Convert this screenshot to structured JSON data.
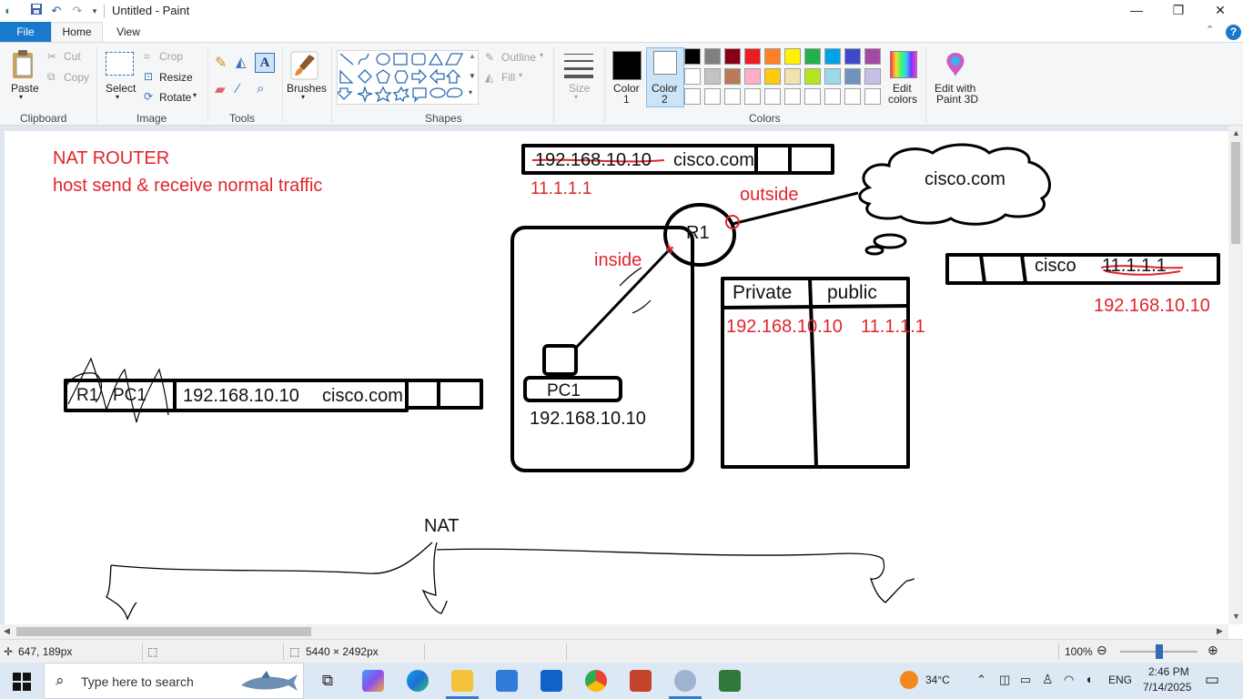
{
  "window": {
    "title": "Untitled - Paint",
    "quick_access": [
      "save-icon",
      "undo-icon",
      "redo-icon",
      "customize-icon"
    ],
    "controls": [
      "minimize",
      "restore",
      "close"
    ]
  },
  "tabs": {
    "file": "File",
    "home": "Home",
    "view": "View",
    "help": "?"
  },
  "ribbon": {
    "clipboard": {
      "paste": "Paste",
      "cut": "Cut",
      "copy": "Copy",
      "label": "Clipboard"
    },
    "image": {
      "select": "Select",
      "crop": "Crop",
      "resize": "Resize",
      "rotate": "Rotate",
      "label": "Image"
    },
    "tools": {
      "label": "Tools"
    },
    "brushes": {
      "label": "Brushes"
    },
    "shapes": {
      "outline": "Outline",
      "fill": "Fill",
      "label": "Shapes"
    },
    "size": {
      "label": "Size"
    },
    "color1": {
      "line1": "Color",
      "line2": "1"
    },
    "color2": {
      "line1": "Color",
      "line2": "2"
    },
    "colors": {
      "label": "Colors",
      "row1": [
        "#000000",
        "#7f7f7f",
        "#880015",
        "#ed1c24",
        "#ff7f27",
        "#fff200",
        "#22b14c",
        "#00a2e8",
        "#3f48cc",
        "#a349a4"
      ],
      "row2": [
        "#ffffff",
        "#c3c3c3",
        "#b97a57",
        "#ffaec9",
        "#ffc90e",
        "#efe4b0",
        "#b5e61d",
        "#99d9ea",
        "#7092be",
        "#c8bfe7"
      ],
      "row3": [
        "#ffffff",
        "#ffffff",
        "#ffffff",
        "#ffffff",
        "#ffffff",
        "#ffffff",
        "#ffffff",
        "#ffffff",
        "#ffffff",
        "#ffffff"
      ]
    },
    "edit_colors": {
      "line1": "Edit",
      "line2": "colors"
    },
    "paint3d": {
      "line1": "Edit with",
      "line2": "Paint 3D"
    }
  },
  "canvas": {
    "heading1": "NAT   ROUTER",
    "heading2": "host send & receive normal traffic",
    "top_packet_ip": "192.168.10.10",
    "top_packet_dest": "cisco.com",
    "top_public_ip": "11.1.1.1",
    "outside_label": "outside",
    "cloud_label": "cisco.com",
    "r1_label": "R1",
    "inside_label": "inside",
    "pc1_label": "PC1",
    "pc1_ip": "192.168.10.10",
    "right_packet_src": "cisco",
    "right_packet_ip": "11.1.1.1",
    "right_packet_newip": "192.168.10.10",
    "table_col1": "Private",
    "table_col2": "public",
    "table_row1_private": "192.168.10.10",
    "table_row1_public": "11.1.1.1",
    "left_packet_r1": "R1",
    "left_packet_pc1": "PC1",
    "left_packet_ip": "192.168.10.10",
    "left_packet_dest": "cisco.com",
    "nat_label": "NAT"
  },
  "status": {
    "cursor": "647, 189px",
    "selection": "",
    "dimensions": "5440 × 2492px",
    "zoom": "100%",
    "zoom_level": 0.5
  },
  "taskbar": {
    "search_placeholder": "Type here to search",
    "weather": "34°C",
    "language": "ENG",
    "time": "2:46 PM",
    "date": "7/14/2025"
  }
}
